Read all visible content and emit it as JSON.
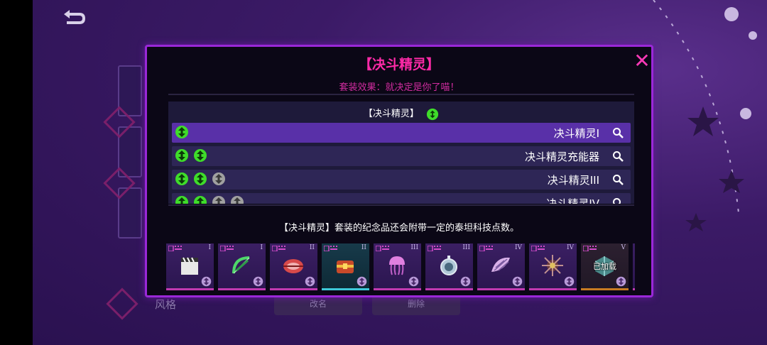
{
  "background": {
    "style_label": "风格",
    "button_1": "改名",
    "button_2": "删除"
  },
  "modal": {
    "title": "【决斗精灵】",
    "set_effect": "套装效果：就决定是你了喵！",
    "close_icon": "close-x-icon",
    "set_header": "【决斗精灵】",
    "rows": [
      {
        "label": "决斗精灵I",
        "coins_green": 1,
        "coins_gray": 0,
        "selected": true
      },
      {
        "label": "决斗精灵充能器",
        "coins_green": 2,
        "coins_gray": 0,
        "selected": false
      },
      {
        "label": "决斗精灵III",
        "coins_green": 2,
        "coins_gray": 1,
        "selected": false
      },
      {
        "label": "决斗精灵IV",
        "coins_green": 2,
        "coins_gray": 2,
        "selected": false
      }
    ],
    "note": "【决斗精灵】套装的纪念品还会附带一定的泰坦科技点数。",
    "items": [
      {
        "roman": "I",
        "icon": "clapperboard-icon",
        "state": "normal"
      },
      {
        "roman": "I",
        "icon": "green-bow-icon",
        "state": "normal"
      },
      {
        "roman": "II",
        "icon": "red-shield-icon",
        "state": "normal"
      },
      {
        "roman": "II",
        "icon": "treasure-chest-icon",
        "state": "selected"
      },
      {
        "roman": "III",
        "icon": "jellyfish-icon",
        "state": "normal"
      },
      {
        "roman": "III",
        "icon": "pocket-watch-icon",
        "state": "normal"
      },
      {
        "roman": "IV",
        "icon": "seashell-icon",
        "state": "normal"
      },
      {
        "roman": "IV",
        "icon": "sea-urchin-icon",
        "state": "normal"
      },
      {
        "roman": "V",
        "icon": "crystal-cube-icon",
        "state": "loaded",
        "loaded_text": "已加载"
      },
      {
        "roman": "",
        "icon": "partial-item-icon",
        "state": "normal"
      }
    ]
  },
  "colors": {
    "title_pink": "#ff2aa8",
    "frame_purple": "#9a28d8",
    "coin_green": "#3fdc2a",
    "coin_gray": "#a0a0a0",
    "selected_row": "#5930a8"
  }
}
